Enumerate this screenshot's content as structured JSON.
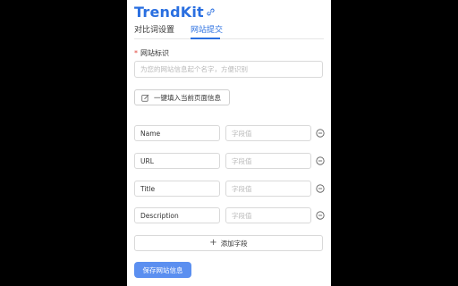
{
  "app": {
    "title": "TrendKit",
    "accent": "#2a6fe0"
  },
  "tabs": [
    {
      "label": "对比词设置",
      "active": false
    },
    {
      "label": "网站提交",
      "active": true
    }
  ],
  "form": {
    "site_label": "网站标识",
    "required_mark": "*",
    "site_placeholder": "为您的网站信息起个名字，方便识别",
    "fill_button": "一键填入当前页面信息",
    "fields": [
      {
        "key": "Name",
        "value_placeholder": "字段值"
      },
      {
        "key": "URL",
        "value_placeholder": "字段值"
      },
      {
        "key": "Title",
        "value_placeholder": "字段值"
      },
      {
        "key": "Description",
        "value_placeholder": "字段值"
      }
    ],
    "add_field": "添加字段",
    "add_icon": "+",
    "save_button": "保存网站信息"
  }
}
